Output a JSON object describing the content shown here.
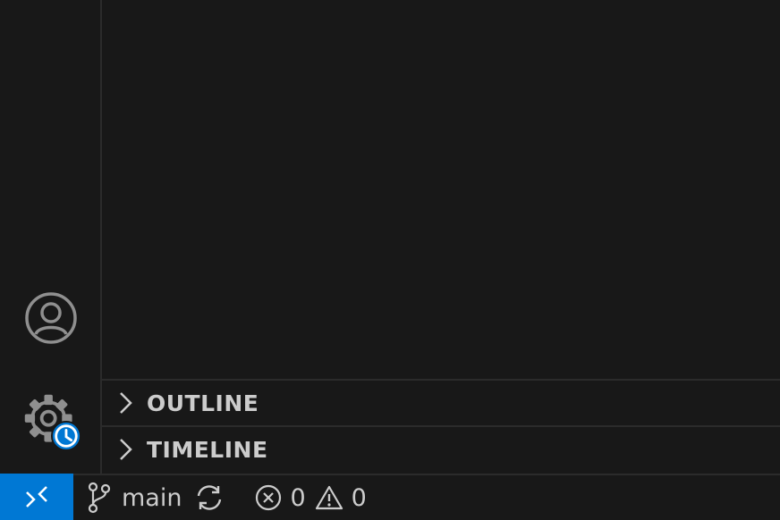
{
  "sidebar": {
    "panes": [
      {
        "title": "OUTLINE",
        "expanded": false
      },
      {
        "title": "TIMELINE",
        "expanded": false
      }
    ]
  },
  "activity_bar": {
    "icons": [
      "account-icon",
      "gear-icon"
    ],
    "manage_badge": "clock-icon"
  },
  "status_bar": {
    "remote_icon": "remote-icon",
    "branch": "main",
    "errors": "0",
    "warnings": "0",
    "accent_color": "#0078d4"
  }
}
